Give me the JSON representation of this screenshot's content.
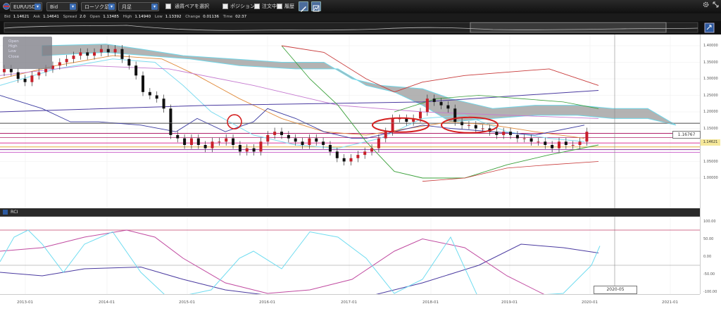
{
  "toolbar": {
    "symbol": "EUR/USD",
    "price_type": "Bid",
    "chart_type": "ローソク足",
    "timeframe": "月足",
    "pair_select_label": "通貨ペアを選択",
    "position_label": "ポジション",
    "order_label": "注文中",
    "history_label": "履歴"
  },
  "quote": {
    "bid_label": "Bid",
    "bid": "1.14621",
    "ask_label": "Ask",
    "ask": "1.14641",
    "spread_label": "Spread",
    "spread": "2.0",
    "open_label": "Open",
    "open": "1.13485",
    "high_label": "High",
    "high": "1.14940",
    "low_label": "Low",
    "low": "1.13392",
    "change_label": "Change",
    "change": "0.01136",
    "time_label": "Time",
    "time": "02:37"
  },
  "ohlc_box": {
    "open": "Open",
    "high": "High",
    "low": "Low",
    "close": "Close"
  },
  "rci_label": "RCI",
  "price_axis_labels": [
    "1.40000",
    "1.35000",
    "1.30000",
    "1.25000",
    "1.20000",
    "1.15000",
    "1.10000",
    "1.05000",
    "1.00000"
  ],
  "rci_axis_labels": [
    "100.00",
    "50.00",
    "0.00",
    "-50.00",
    "-100.00"
  ],
  "x_axis_labels": [
    "2013-01",
    "2014-01",
    "2015-01",
    "2016-01",
    "2017-01",
    "2018-01",
    "2019-01",
    "2020-01",
    "2021-01"
  ],
  "current_price_tag": "1.14621",
  "crosshair_price_tag": "1.16767",
  "crosshair_date_tag": "2020-05",
  "colors": {
    "bull": "#c8202a",
    "bear": "#111111",
    "cloud": "#9a9a9a",
    "annotation": "#d42020"
  }
}
